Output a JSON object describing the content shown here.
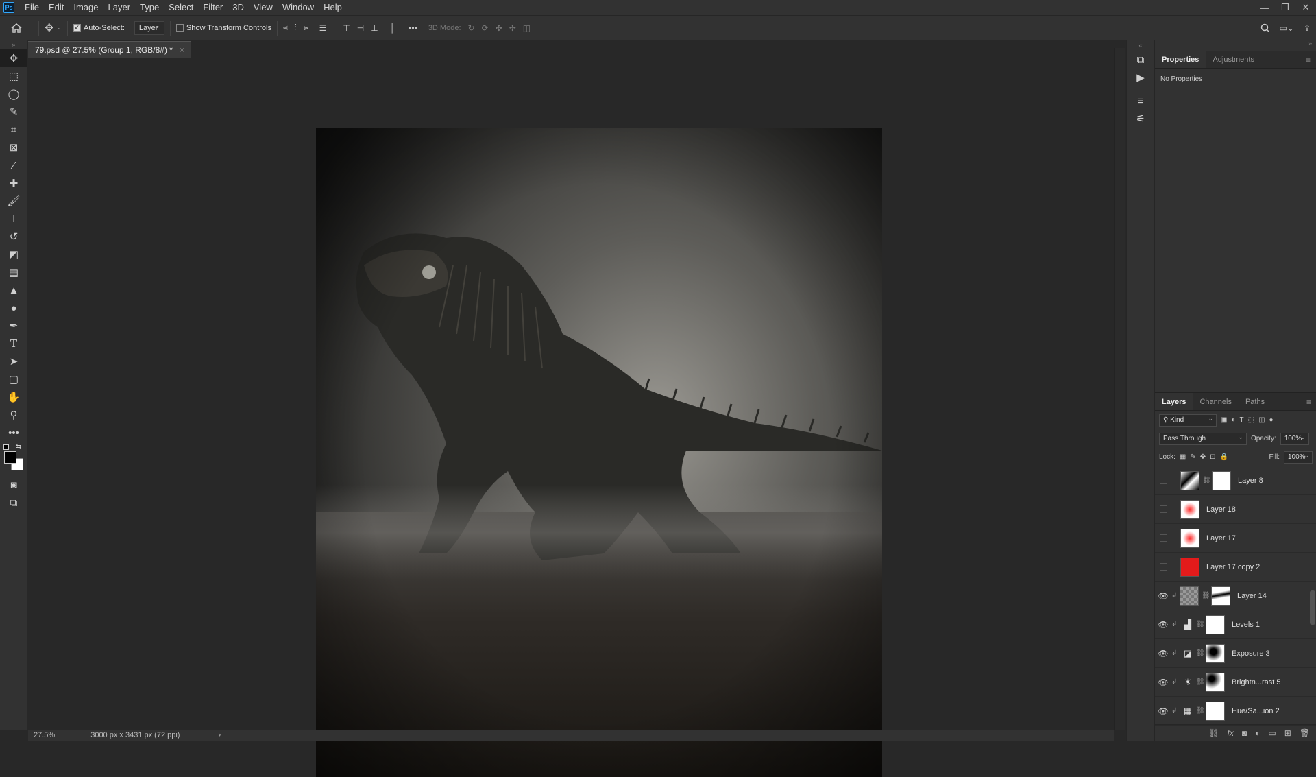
{
  "app": {
    "logo": "Ps"
  },
  "menu": [
    "File",
    "Edit",
    "Image",
    "Layer",
    "Type",
    "Select",
    "Filter",
    "3D",
    "View",
    "Window",
    "Help"
  ],
  "window_controls": [
    "—",
    "❐",
    "✕"
  ],
  "options": {
    "auto_select_label": "Auto-Select:",
    "auto_select_value": "Layer",
    "show_transform_label": "Show Transform Controls",
    "mode_3d_label": "3D Mode:"
  },
  "document": {
    "tab_title": "79.psd @ 27.5% (Group 1, RGB/8#) *",
    "zoom": "27.5%",
    "dimensions": "3000 px x 3431 px (72 ppi)"
  },
  "properties_panel": {
    "tabs": [
      "Properties",
      "Adjustments"
    ],
    "body": "No Properties"
  },
  "layers_panel": {
    "tabs": [
      "Layers",
      "Channels",
      "Paths"
    ],
    "filter_kind": "Kind",
    "blend_mode": "Pass Through",
    "opacity_label": "Opacity:",
    "opacity_value": "100%",
    "lock_label": "Lock:",
    "fill_label": "Fill:",
    "fill_value": "100%",
    "layers": [
      {
        "name": "Layer 8",
        "visible": false
      },
      {
        "name": "Layer 18",
        "visible": false
      },
      {
        "name": "Layer 17",
        "visible": false
      },
      {
        "name": "Layer 17 copy 2",
        "visible": false
      },
      {
        "name": "Layer 14",
        "visible": true
      },
      {
        "name": "Levels 1",
        "visible": true
      },
      {
        "name": "Exposure 3",
        "visible": true
      },
      {
        "name": "Brightn...rast 5",
        "visible": true
      },
      {
        "name": "Hue/Sa...ion 2",
        "visible": true
      }
    ]
  }
}
